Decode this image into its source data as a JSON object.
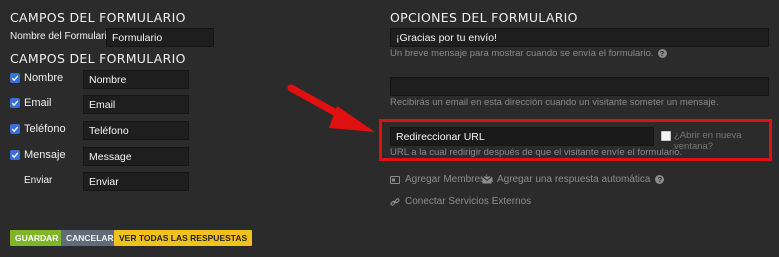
{
  "left": {
    "heading1": "CAMPOS DEL FORMULARIO",
    "form_name_label": "Nombre del Formulario",
    "form_name_value": "Formulario",
    "heading2": "CAMPOS DEL FORMULARIO",
    "fields": [
      {
        "label": "Nombre",
        "value": "Nombre",
        "checked": true
      },
      {
        "label": "Email",
        "value": "Email",
        "checked": true
      },
      {
        "label": "Teléfono",
        "value": "Teléfono",
        "checked": true
      },
      {
        "label": "Mensaje",
        "value": "Message",
        "checked": true
      },
      {
        "label": "Enviar",
        "value": "Enviar",
        "checked": false
      }
    ]
  },
  "right": {
    "heading": "OPCIONES DEL FORMULARIO",
    "thanks_value": "¡Gracias por tu envío!",
    "thanks_help": "Un breve mensaje para mostrar cuando se envía el formulario.",
    "email_value": "",
    "email_help": "Recibirás un email en esta dirección cuando un visitante someter un mensaje.",
    "redirect_value": "Redireccionar URL",
    "new_window_label": "¿Abrir en nueva ventana?",
    "redirect_help": "URL a la cual redirigir después de que el visitante envíe el formulario.",
    "membership_link": "Agregar Membresía",
    "autoreply_link": "Agregar una respuesta automática",
    "external_link": "Conectar Servicios Externos"
  },
  "buttons": {
    "save": "GUARDAR",
    "cancel": "CANCELAR",
    "view_all": "VER TODAS LAS RESPUESTAS"
  },
  "colors": {
    "background": "#2b2b2b",
    "highlight": "#e01010",
    "save": "#7fb628",
    "cancel": "#5e6b78",
    "view_all": "#f2c11c",
    "checkbox": "#3a6fd8"
  }
}
